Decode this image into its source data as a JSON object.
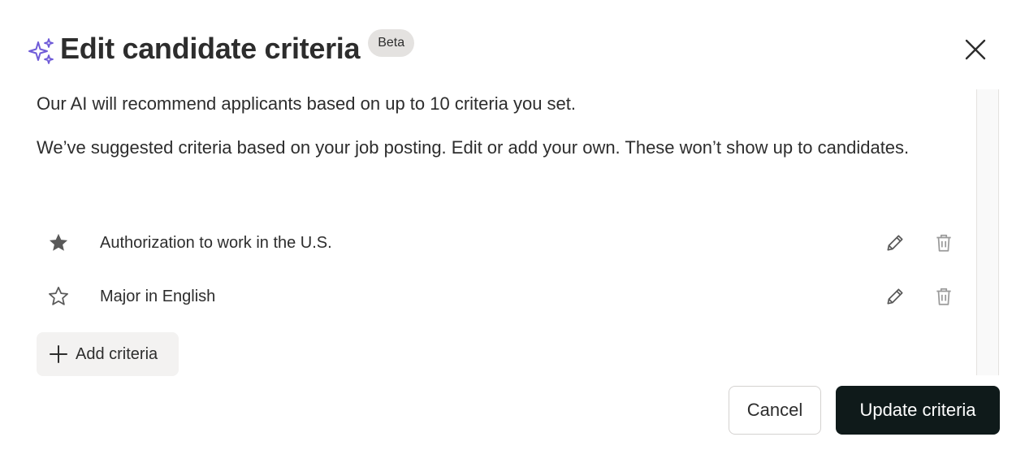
{
  "dialog": {
    "title": "Edit candidate criteria",
    "badge": "Beta",
    "intro_1": "Our AI will recommend applicants based on up to 10 criteria you set.",
    "intro_2": "We’ve suggested criteria based on your job posting. Edit or add your own. These won’t show up to candidates.",
    "criteria": [
      {
        "label": "Authorization to work in the U.S.",
        "starred": true
      },
      {
        "label": "Major in English",
        "starred": false
      }
    ],
    "add_label": "Add criteria",
    "cancel_label": "Cancel",
    "update_label": "Update criteria"
  },
  "icons": {
    "title": "sparkle-icon",
    "close": "close-icon",
    "star_filled": "star-filled-icon",
    "star_outline": "star-outline-icon",
    "edit": "pencil-icon",
    "delete": "trash-icon",
    "add": "plus-icon"
  },
  "colors": {
    "sparkle": "#6f5bd8",
    "primary_button": "#0f1a1a",
    "text": "#2d2d2d",
    "badge_bg": "#e4e2e0"
  }
}
